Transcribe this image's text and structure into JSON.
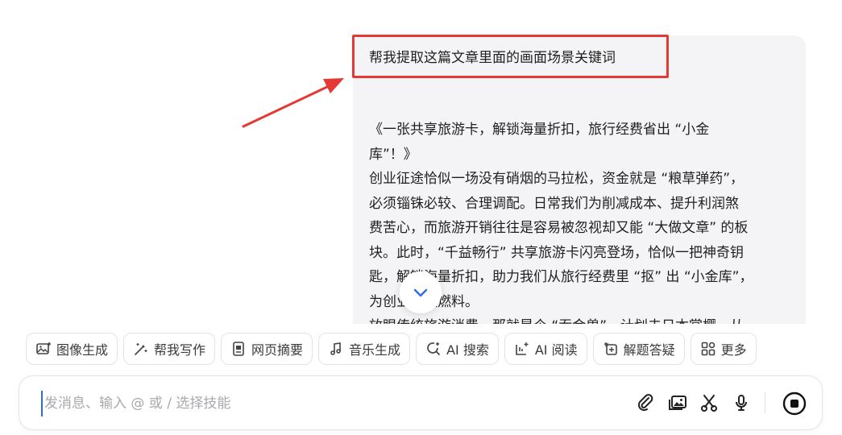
{
  "message": {
    "title": "帮我提取这篇文章里面的画面场景关键词",
    "lines": [
      "《一张共享旅游卡，解锁海量折扣，旅行经费省出 “小金",
      "库”！》",
      "创业征途恰似一场没有硝烟的马拉松，资金就是 “粮草弹药”，",
      "必须锱铢必较、合理调配。日常我们为削减成本、提升利润煞",
      "费苦心，而旅游开销往往是容易被忽视却又能 “大做文章” 的板",
      "块。此时，“千益畅行” 共享旅游卡闪亮登场，恰似一把神奇钥",
      "匙，解锁海量折扣，助力我们从旅行经费里 “抠” 出 “小金库”，",
      "为创业添足燃料。",
      "放眼传统旅游消费，那就是个 “吞金兽”。计划去日本赏樱，从"
    ]
  },
  "skills": [
    {
      "label": "图像生成",
      "icon": "image-plus-icon"
    },
    {
      "label": "帮我写作",
      "icon": "magic-pen-icon"
    },
    {
      "label": "网页摘要",
      "icon": "web-page-icon"
    },
    {
      "label": "音乐生成",
      "icon": "music-note-icon"
    },
    {
      "label": "AI 搜索",
      "icon": "ai-search-icon"
    },
    {
      "label": "AI 阅读",
      "icon": "ai-read-icon"
    },
    {
      "label": "解题答疑",
      "icon": "question-icon"
    },
    {
      "label": "更多",
      "icon": "grid-more-icon"
    }
  ],
  "input": {
    "placeholder": "发消息、输入 @ 或 / 选择技能",
    "value": ""
  },
  "colors": {
    "highlight": "#e53935",
    "accent": "#2b6de8",
    "bubble_bg": "#f4f4f6"
  }
}
